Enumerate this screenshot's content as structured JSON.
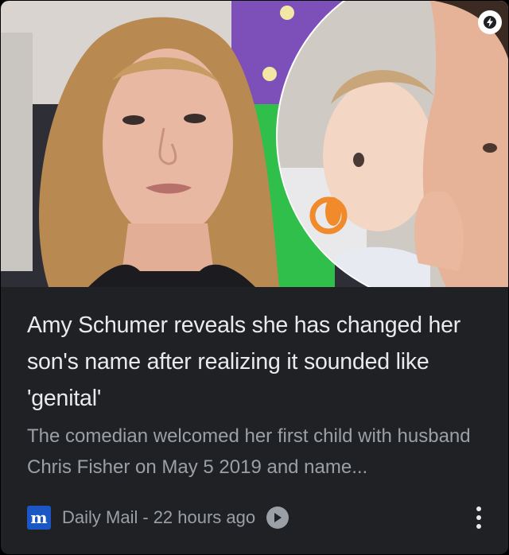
{
  "article": {
    "headline": "Amy Schumer reveals she has changed her son's name after realizing it sounded like 'genital'",
    "snippet": "The comedian welcomed her first child with husband Chris Fisher on May 5 2019 and name...",
    "image_icon": "amp-lightning-icon"
  },
  "footer": {
    "favicon_letter": "m",
    "source": "Daily Mail",
    "separator": "-",
    "time": "22 hours ago",
    "play_icon": "play-icon",
    "menu_icon": "more-vert-icon"
  },
  "colors": {
    "card_bg": "#202124",
    "headline": "#e8eaed",
    "secondary": "#9aa0a6",
    "favicon_bg": "#1a56c4"
  }
}
